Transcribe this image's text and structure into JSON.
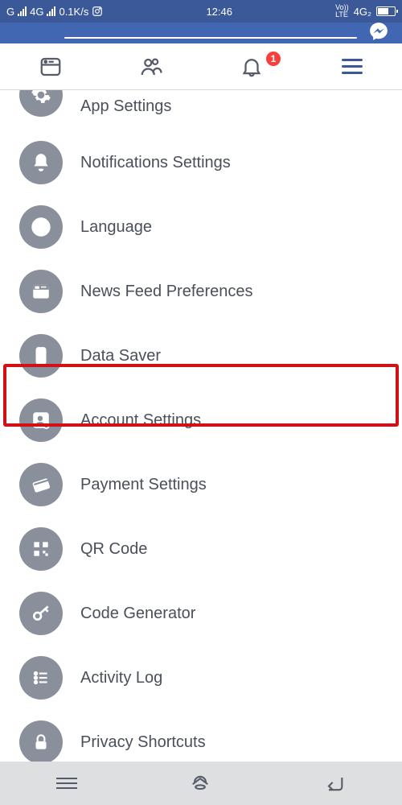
{
  "status": {
    "network_type_left": "G",
    "network_4g": "4G",
    "speed": "0.1K/s",
    "time": "12:46",
    "volte": "Vo))\nLTE",
    "net_right": "4G₂",
    "battery_pct": 60
  },
  "tabs": {
    "badge_count": "1"
  },
  "menu": [
    {
      "key": "app-settings",
      "label": "App Settings",
      "icon": "gear"
    },
    {
      "key": "notifications",
      "label": "Notifications Settings",
      "icon": "bell"
    },
    {
      "key": "language",
      "label": "Language",
      "icon": "globe"
    },
    {
      "key": "news-feed",
      "label": "News Feed Preferences",
      "icon": "feed"
    },
    {
      "key": "data-saver",
      "label": "Data Saver",
      "icon": "phone"
    },
    {
      "key": "account-settings",
      "label": "Account Settings",
      "icon": "person-gear"
    },
    {
      "key": "payment-settings",
      "label": "Payment Settings",
      "icon": "card"
    },
    {
      "key": "qr-code",
      "label": "QR Code",
      "icon": "qr"
    },
    {
      "key": "code-generator",
      "label": "Code Generator",
      "icon": "key"
    },
    {
      "key": "activity-log",
      "label": "Activity Log",
      "icon": "list"
    },
    {
      "key": "privacy-shortcuts",
      "label": "Privacy Shortcuts",
      "icon": "lock"
    }
  ],
  "highlighted_key": "account-settings",
  "colors": {
    "brand": "#3b5998",
    "icon_bg": "#8a8f9c",
    "text": "#4a4f5a",
    "highlight": "#d01216",
    "badge": "#fa3e3e"
  }
}
